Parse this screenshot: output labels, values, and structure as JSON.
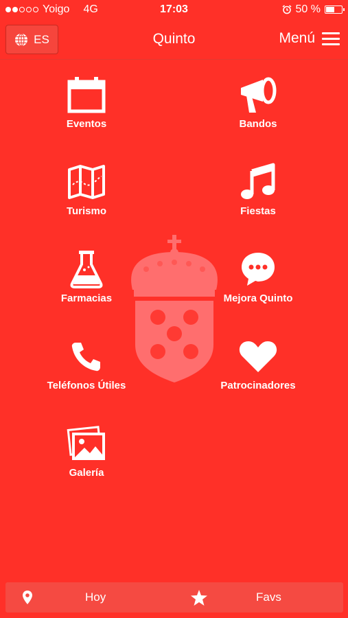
{
  "status_bar": {
    "carrier": "Yoigo",
    "network": "4G",
    "time": "17:03",
    "battery_percent": "50 %",
    "battery_level": 0.5,
    "signal_bars": 2,
    "signal_total": 5
  },
  "nav": {
    "language": "ES",
    "title": "Quinto",
    "menu_label": "Menú"
  },
  "grid": [
    {
      "label": "Eventos",
      "icon": "calendar-icon"
    },
    {
      "label": "Bandos",
      "icon": "megaphone-icon"
    },
    {
      "label": "Turismo",
      "icon": "map-icon"
    },
    {
      "label": "Fiestas",
      "icon": "music-note-icon"
    },
    {
      "label": "Farmacias",
      "icon": "flask-icon"
    },
    {
      "label": "Mejora Quinto",
      "icon": "chat-bubble-icon"
    },
    {
      "label": "Teléfonos Útiles",
      "icon": "phone-icon"
    },
    {
      "label": "Patrocinadores",
      "icon": "heart-icon"
    },
    {
      "label": "Galería",
      "icon": "photos-icon"
    }
  ],
  "tabbar": {
    "today_label": "Hoy",
    "favs_label": "Favs"
  },
  "colors": {
    "background": "#ff3028",
    "foreground": "#ffffff"
  }
}
